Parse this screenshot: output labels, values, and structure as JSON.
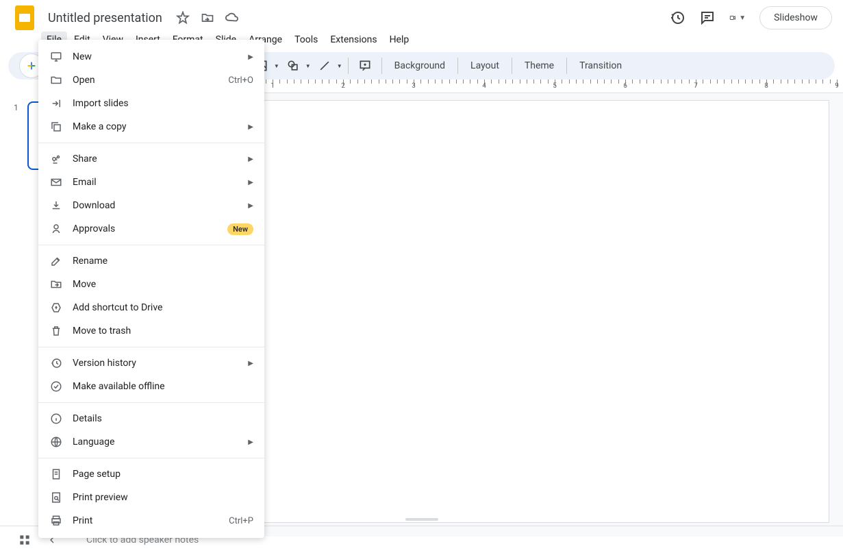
{
  "header": {
    "title": "Untitled presentation"
  },
  "menubar": [
    "File",
    "Edit",
    "View",
    "Insert",
    "Format",
    "Slide",
    "Arrange",
    "Tools",
    "Extensions",
    "Help"
  ],
  "toolbar": {
    "background": "Background",
    "layout": "Layout",
    "theme": "Theme",
    "transition": "Transition"
  },
  "slideshow_label": "Slideshow",
  "ruler_marks": [
    1,
    2,
    3,
    4,
    5,
    6,
    7,
    8,
    9
  ],
  "thumbs": [
    {
      "num": "1"
    }
  ],
  "file_menu": [
    {
      "type": "item",
      "icon": "monitor",
      "label": "New",
      "arrow": true
    },
    {
      "type": "item",
      "icon": "folder",
      "label": "Open",
      "shortcut": "Ctrl+O"
    },
    {
      "type": "item",
      "icon": "import",
      "label": "Import slides"
    },
    {
      "type": "item",
      "icon": "copy",
      "label": "Make a copy",
      "arrow": true
    },
    {
      "type": "sep"
    },
    {
      "type": "item",
      "icon": "share",
      "label": "Share",
      "arrow": true
    },
    {
      "type": "item",
      "icon": "email",
      "label": "Email",
      "arrow": true
    },
    {
      "type": "item",
      "icon": "download",
      "label": "Download",
      "arrow": true
    },
    {
      "type": "item",
      "icon": "approval",
      "label": "Approvals",
      "badge": "New"
    },
    {
      "type": "sep"
    },
    {
      "type": "item",
      "icon": "rename",
      "label": "Rename"
    },
    {
      "type": "item",
      "icon": "move",
      "label": "Move"
    },
    {
      "type": "item",
      "icon": "drive-shortcut",
      "label": "Add shortcut to Drive"
    },
    {
      "type": "item",
      "icon": "trash",
      "label": "Move to trash"
    },
    {
      "type": "sep"
    },
    {
      "type": "item",
      "icon": "history",
      "label": "Version history",
      "arrow": true
    },
    {
      "type": "item",
      "icon": "offline",
      "label": "Make available offline"
    },
    {
      "type": "sep"
    },
    {
      "type": "item",
      "icon": "info",
      "label": "Details"
    },
    {
      "type": "item",
      "icon": "globe",
      "label": "Language",
      "arrow": true
    },
    {
      "type": "sep"
    },
    {
      "type": "item",
      "icon": "page",
      "label": "Page setup"
    },
    {
      "type": "item",
      "icon": "preview",
      "label": "Print preview"
    },
    {
      "type": "item",
      "icon": "print",
      "label": "Print",
      "shortcut": "Ctrl+P"
    }
  ],
  "notes_placeholder": "Click to add speaker notes"
}
